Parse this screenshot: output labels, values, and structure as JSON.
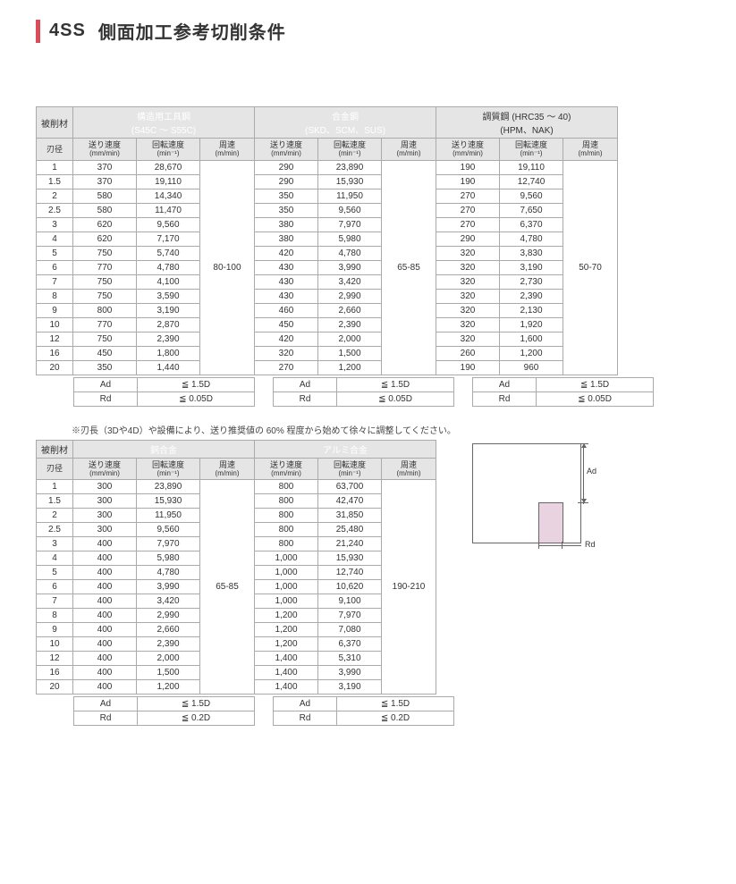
{
  "title": {
    "code": "4SS",
    "text": "側面加工参考切削条件"
  },
  "labels": {
    "material": "被削材",
    "dia": "刃径",
    "feed": "送り速度",
    "feed_unit": "(mm/min)",
    "rpm": "回転速度",
    "rpm_unit": "(min⁻¹)",
    "speed": "周速",
    "speed_unit": "(m/min)",
    "ad": "Ad",
    "rd": "Rd"
  },
  "table1": {
    "materials": [
      {
        "name": "構造用工具鋼",
        "sub": "(S45C ～ S55C)",
        "cls": "mat-a"
      },
      {
        "name": "合金鋼",
        "sub": "(SKD、SCM、SUS)",
        "cls": "mat-b"
      },
      {
        "name": "調質鋼 (HRC35 ～ 40)",
        "sub": "(HPM、NAK)",
        "cls": "mat-c"
      }
    ],
    "speeds": [
      "80-100",
      "65-85",
      "50-70"
    ],
    "dia": [
      "1",
      "1.5",
      "2",
      "2.5",
      "3",
      "4",
      "5",
      "6",
      "7",
      "8",
      "9",
      "10",
      "12",
      "16",
      "20"
    ],
    "data": [
      [
        [
          "370",
          "28,670"
        ],
        [
          "290",
          "23,890"
        ],
        [
          "190",
          "19,110"
        ]
      ],
      [
        [
          "370",
          "19,110"
        ],
        [
          "290",
          "15,930"
        ],
        [
          "190",
          "12,740"
        ]
      ],
      [
        [
          "580",
          "14,340"
        ],
        [
          "350",
          "11,950"
        ],
        [
          "270",
          "9,560"
        ]
      ],
      [
        [
          "580",
          "11,470"
        ],
        [
          "350",
          "9,560"
        ],
        [
          "270",
          "7,650"
        ]
      ],
      [
        [
          "620",
          "9,560"
        ],
        [
          "380",
          "7,970"
        ],
        [
          "270",
          "6,370"
        ]
      ],
      [
        [
          "620",
          "7,170"
        ],
        [
          "380",
          "5,980"
        ],
        [
          "290",
          "4,780"
        ]
      ],
      [
        [
          "750",
          "5,740"
        ],
        [
          "420",
          "4,780"
        ],
        [
          "320",
          "3,830"
        ]
      ],
      [
        [
          "770",
          "4,780"
        ],
        [
          "430",
          "3,990"
        ],
        [
          "320",
          "3,190"
        ]
      ],
      [
        [
          "750",
          "4,100"
        ],
        [
          "430",
          "3,420"
        ],
        [
          "320",
          "2,730"
        ]
      ],
      [
        [
          "750",
          "3,590"
        ],
        [
          "430",
          "2,990"
        ],
        [
          "320",
          "2,390"
        ]
      ],
      [
        [
          "800",
          "3,190"
        ],
        [
          "460",
          "2,660"
        ],
        [
          "320",
          "2,130"
        ]
      ],
      [
        [
          "770",
          "2,870"
        ],
        [
          "450",
          "2,390"
        ],
        [
          "320",
          "1,920"
        ]
      ],
      [
        [
          "750",
          "2,390"
        ],
        [
          "420",
          "2,000"
        ],
        [
          "320",
          "1,600"
        ]
      ],
      [
        [
          "450",
          "1,800"
        ],
        [
          "320",
          "1,500"
        ],
        [
          "260",
          "1,200"
        ]
      ],
      [
        [
          "350",
          "1,440"
        ],
        [
          "270",
          "1,200"
        ],
        [
          "190",
          "960"
        ]
      ]
    ],
    "adrd": [
      {
        "ad": "≦ 1.5D",
        "rd": "≦ 0.05D"
      },
      {
        "ad": "≦ 1.5D",
        "rd": "≦ 0.05D"
      },
      {
        "ad": "≦ 1.5D",
        "rd": "≦ 0.05D"
      }
    ]
  },
  "footnote": "※刃長（3Dや4D）や設備により、送り推奨値の 60% 程度から始めて徐々に調整してください。",
  "table2": {
    "materials": [
      {
        "name": "銅合金",
        "sub": "",
        "cls": "mat-d"
      },
      {
        "name": "アルミ合金",
        "sub": "",
        "cls": "mat-e"
      }
    ],
    "speeds": [
      "65-85",
      "190-210"
    ],
    "dia": [
      "1",
      "1.5",
      "2",
      "2.5",
      "3",
      "4",
      "5",
      "6",
      "7",
      "8",
      "9",
      "10",
      "12",
      "16",
      "20"
    ],
    "data": [
      [
        [
          "300",
          "23,890"
        ],
        [
          "800",
          "63,700"
        ]
      ],
      [
        [
          "300",
          "15,930"
        ],
        [
          "800",
          "42,470"
        ]
      ],
      [
        [
          "300",
          "11,950"
        ],
        [
          "800",
          "31,850"
        ]
      ],
      [
        [
          "300",
          "9,560"
        ],
        [
          "800",
          "25,480"
        ]
      ],
      [
        [
          "400",
          "7,970"
        ],
        [
          "800",
          "21,240"
        ]
      ],
      [
        [
          "400",
          "5,980"
        ],
        [
          "1,000",
          "15,930"
        ]
      ],
      [
        [
          "400",
          "4,780"
        ],
        [
          "1,000",
          "12,740"
        ]
      ],
      [
        [
          "400",
          "3,990"
        ],
        [
          "1,000",
          "10,620"
        ]
      ],
      [
        [
          "400",
          "3,420"
        ],
        [
          "1,000",
          "9,100"
        ]
      ],
      [
        [
          "400",
          "2,990"
        ],
        [
          "1,200",
          "7,970"
        ]
      ],
      [
        [
          "400",
          "2,660"
        ],
        [
          "1,200",
          "7,080"
        ]
      ],
      [
        [
          "400",
          "2,390"
        ],
        [
          "1,200",
          "6,370"
        ]
      ],
      [
        [
          "400",
          "2,000"
        ],
        [
          "1,400",
          "5,310"
        ]
      ],
      [
        [
          "400",
          "1,500"
        ],
        [
          "1,400",
          "3,990"
        ]
      ],
      [
        [
          "400",
          "1,200"
        ],
        [
          "1,400",
          "3,190"
        ]
      ]
    ],
    "adrd": [
      {
        "ad": "≦ 1.5D",
        "rd": "≦ 0.2D"
      },
      {
        "ad": "≦ 1.5D",
        "rd": "≦ 0.2D"
      }
    ]
  },
  "diagram": {
    "ad": "Ad",
    "rd": "Rd"
  }
}
